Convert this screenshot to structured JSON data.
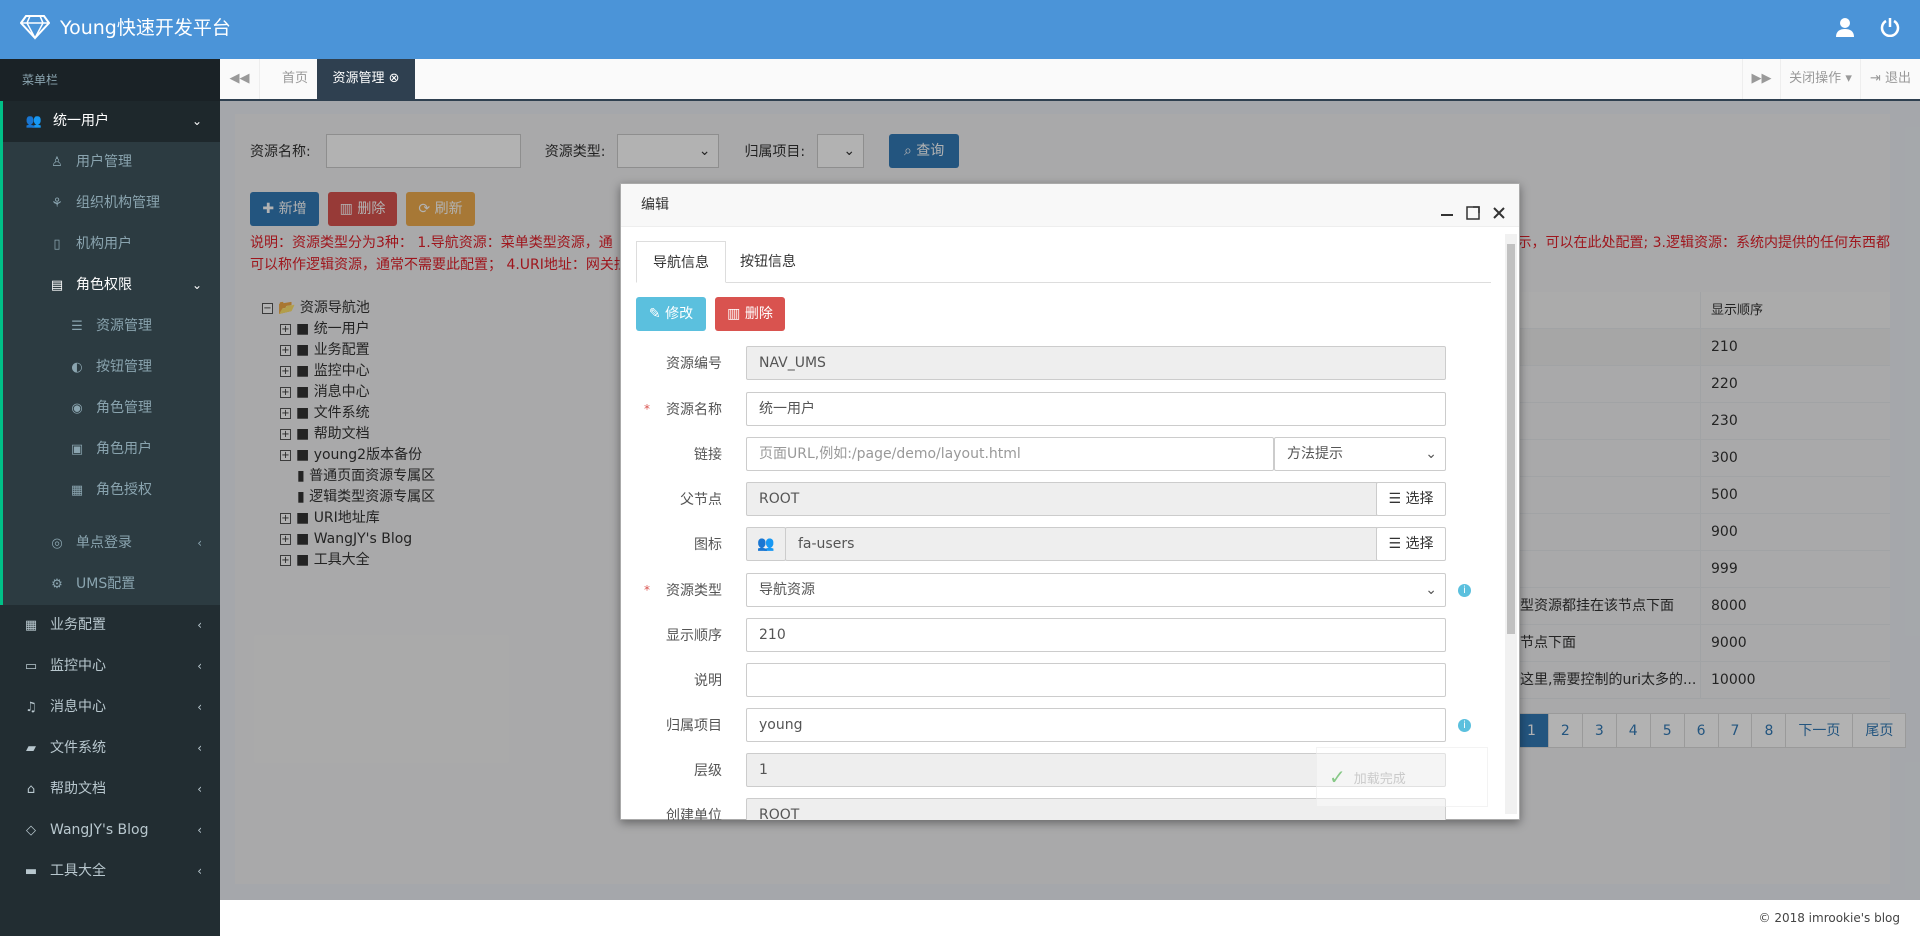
{
  "app": {
    "title": "Young快速开发平台"
  },
  "sidebar": {
    "title": "菜单栏",
    "items": [
      {
        "label": "统一用户",
        "icon": "users-icon",
        "arrow": "⌄"
      },
      {
        "label": "用户管理",
        "icon": "user-icon"
      },
      {
        "label": "组织机构管理",
        "icon": "sitemap-icon"
      },
      {
        "label": "机构用户",
        "icon": "building-icon"
      },
      {
        "label": "角色权限",
        "icon": "id-card-icon",
        "arrow": "⌄"
      },
      {
        "label": "资源管理",
        "icon": "list-icon"
      },
      {
        "label": "按钮管理",
        "icon": "toggle-icon"
      },
      {
        "label": "角色管理",
        "icon": "user-circle-icon"
      },
      {
        "label": "角色用户",
        "icon": "address-card-icon"
      },
      {
        "label": "角色授权",
        "icon": "key-icon"
      },
      {
        "label": "单点登录",
        "icon": "dot-circle-icon",
        "arrow": "‹"
      },
      {
        "label": "UMS配置",
        "icon": "cogs-icon"
      },
      {
        "label": "业务配置",
        "icon": "th-icon",
        "arrow": "‹"
      },
      {
        "label": "监控中心",
        "icon": "desktop-icon",
        "arrow": "‹"
      },
      {
        "label": "消息中心",
        "icon": "bell-icon",
        "arrow": "‹"
      },
      {
        "label": "文件系统",
        "icon": "folder-icon",
        "arrow": "‹"
      },
      {
        "label": "帮助文档",
        "icon": "graduation-icon",
        "arrow": "‹"
      },
      {
        "label": "WangJY's Blog",
        "icon": "diamond-icon",
        "arrow": "‹"
      },
      {
        "label": "工具大全",
        "icon": "briefcase-icon",
        "arrow": "‹"
      }
    ]
  },
  "tabs": {
    "home": "首页",
    "current": "资源管理",
    "close_ops": "关闭操作",
    "logout": "退出"
  },
  "search": {
    "name_label": "资源名称:",
    "type_label": "资源类型:",
    "project_label": "归属项目:",
    "query": "查询"
  },
  "toolbar": {
    "add": "新增",
    "delete": "删除",
    "refresh": "刷新"
  },
  "note": {
    "line1": "说明：资源类型分为3种： 1.导航资源：菜单类型资源，通",
    "line1b": "示，可以在此处配置; 3.逻辑资源：系统内提供的任何东西都",
    "line2": "可以称作逻辑资源，通常不需要此配置； 4.URI地址：网关拦"
  },
  "tree": {
    "root": "资源导航池",
    "children": [
      "统一用户",
      "业务配置",
      "监控中心",
      "消息中心",
      "文件系统",
      "帮助文档",
      "young2版本备份",
      "普通页面资源专属区",
      "逻辑类型资源专属区",
      "URI地址库",
      "WangJY's Blog",
      "工具大全"
    ]
  },
  "table": {
    "col_header": "显示顺序",
    "rows": [
      {
        "text": "",
        "order": "210"
      },
      {
        "text": "",
        "order": "220"
      },
      {
        "text": "",
        "order": "230"
      },
      {
        "text": "",
        "order": "300"
      },
      {
        "text": "",
        "order": "500"
      },
      {
        "text": "",
        "order": "900"
      },
      {
        "text": "",
        "order": "999"
      },
      {
        "text": "型资源都挂在该节点下面",
        "order": "8000"
      },
      {
        "text": "节点下面",
        "order": "9000"
      },
      {
        "text": "这里,需要控制的uri太多的...",
        "order": "10000"
      }
    ]
  },
  "pager": {
    "pages": [
      "1",
      "2",
      "3",
      "4",
      "5",
      "6",
      "7",
      "8"
    ],
    "next": "下一页",
    "last": "尾页"
  },
  "modal": {
    "title": "编辑",
    "tab_nav": "导航信息",
    "tab_btn": "按钮信息",
    "edit": "修改",
    "delete": "删除",
    "fields": {
      "code_label": "资源编号",
      "code": "NAV_UMS",
      "name_label": "资源名称",
      "name": "统一用户",
      "link_label": "链接",
      "link_placeholder": "页面URL,例如:/page/demo/layout.html",
      "method": "方法提示",
      "parent_label": "父节点",
      "parent": "ROOT",
      "choose": "选择",
      "icon_label": "图标",
      "icon": "fa-users",
      "type_label": "资源类型",
      "type": "导航资源",
      "order_label": "显示顺序",
      "order": "210",
      "desc_label": "说明",
      "desc": "",
      "project_label": "归属项目",
      "project": "young",
      "level_label": "层级",
      "level": "1",
      "unit_label": "创建单位",
      "unit": "ROOT"
    },
    "loading": "加载完成"
  },
  "footer": {
    "text": "© 2018 imrookie's blog"
  }
}
